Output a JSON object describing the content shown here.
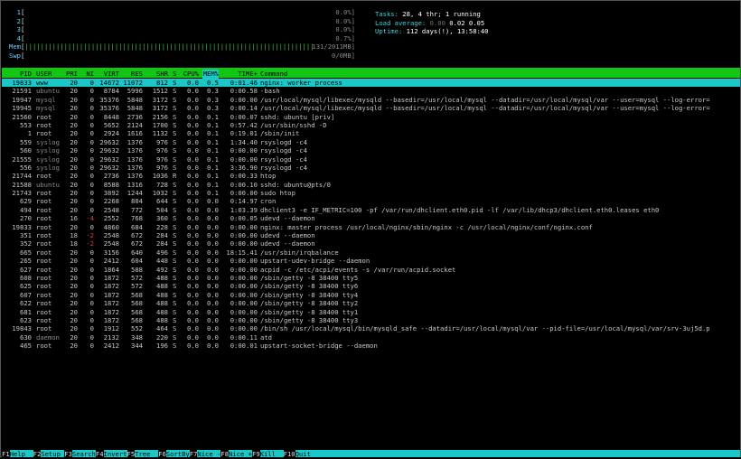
{
  "meters": [
    {
      "label": "1",
      "bar": "",
      "value": "0.0%]"
    },
    {
      "label": "2",
      "bar": "",
      "value": "0.0%]"
    },
    {
      "label": "3",
      "bar": "",
      "value": "0.0%]"
    },
    {
      "label": "4",
      "bar": "",
      "value": "0.7%]"
    },
    {
      "label": "Mem",
      "bar": "||||||||||||||||||||||||||||||||||||||||||||||||||||||||||||||||||||||||||",
      "value": "131/2011MB]"
    },
    {
      "label": "Swp",
      "bar": "",
      "value": "0/0MB]"
    }
  ],
  "stats": {
    "tasks_label": "Tasks: ",
    "tasks_value": "28, 4 thr; 1 running",
    "load_label": "Load average: ",
    "load_1": "0.00",
    "load_5": "0.02",
    "load_15": "0.05",
    "uptime_label": "Uptime: ",
    "uptime_value": "112 days(!), 13:58:40"
  },
  "columns": {
    "pid": "PID",
    "user": "USER",
    "pri": "PRI",
    "ni": "NI",
    "virt": "VIRT",
    "res": "RES",
    "shr": "SHR",
    "s": "S",
    "cpu": "CPU%",
    "mem": "MEM%",
    "time": "TIME+",
    "cmd": "Command"
  },
  "processes": [
    {
      "pid": "19833",
      "user": "www",
      "pri": "20",
      "ni": "0",
      "virt": "14672",
      "res": "11072",
      "shr": "812",
      "s": "S",
      "cpu": "0.0",
      "mem": "0.5",
      "time": "0:01.46",
      "cmd": "nginx: worker process"
    },
    {
      "pid": "21591",
      "user": "ubuntu",
      "pri": "20",
      "ni": "0",
      "virt": "8784",
      "res": "5996",
      "shr": "1512",
      "s": "S",
      "cpu": "0.0",
      "mem": "0.3",
      "time": "0:00.58",
      "cmd": "-bash"
    },
    {
      "pid": "19947",
      "user": "mysql",
      "pri": "20",
      "ni": "0",
      "virt": "35376",
      "res": "5848",
      "shr": "3172",
      "s": "S",
      "cpu": "0.0",
      "mem": "0.3",
      "time": "0:00.00",
      "cmd": "/usr/local/mysql/libexec/mysqld --basedir=/usr/local/mysql --datadir=/usr/local/mysql/var --user=mysql --log-error="
    },
    {
      "pid": "19945",
      "user": "mysql",
      "pri": "20",
      "ni": "0",
      "virt": "35376",
      "res": "5848",
      "shr": "3172",
      "s": "S",
      "cpu": "0.0",
      "mem": "0.3",
      "time": "0:00.14",
      "cmd": "/usr/local/mysql/libexec/mysqld --basedir=/usr/local/mysql --datadir=/usr/local/mysql/var --user=mysql --log-error="
    },
    {
      "pid": "21560",
      "user": "root",
      "pri": "20",
      "ni": "0",
      "virt": "8448",
      "res": "2736",
      "shr": "2156",
      "s": "S",
      "cpu": "0.0",
      "mem": "0.1",
      "time": "0:00.07",
      "cmd": "sshd: ubuntu [priv]"
    },
    {
      "pid": "553",
      "user": "root",
      "pri": "20",
      "ni": "0",
      "virt": "5652",
      "res": "2124",
      "shr": "1700",
      "s": "S",
      "cpu": "0.0",
      "mem": "0.1",
      "time": "0:57.42",
      "cmd": "/usr/sbin/sshd -D"
    },
    {
      "pid": "1",
      "user": "root",
      "pri": "20",
      "ni": "0",
      "virt": "2924",
      "res": "1616",
      "shr": "1132",
      "s": "S",
      "cpu": "0.0",
      "mem": "0.1",
      "time": "0:19.01",
      "cmd": "/sbin/init"
    },
    {
      "pid": "559",
      "user": "syslog",
      "pri": "20",
      "ni": "0",
      "virt": "29632",
      "res": "1376",
      "shr": "976",
      "s": "S",
      "cpu": "0.0",
      "mem": "0.1",
      "time": "1:34.40",
      "cmd": "rsyslogd -c4"
    },
    {
      "pid": "560",
      "user": "syslog",
      "pri": "20",
      "ni": "0",
      "virt": "29632",
      "res": "1376",
      "shr": "976",
      "s": "S",
      "cpu": "0.0",
      "mem": "0.1",
      "time": "0:00.00",
      "cmd": "rsyslogd -c4"
    },
    {
      "pid": "21555",
      "user": "syslog",
      "pri": "20",
      "ni": "0",
      "virt": "29632",
      "res": "1376",
      "shr": "976",
      "s": "S",
      "cpu": "0.0",
      "mem": "0.1",
      "time": "0:00.00",
      "cmd": "rsyslogd -c4"
    },
    {
      "pid": "556",
      "user": "syslog",
      "pri": "20",
      "ni": "0",
      "virt": "29632",
      "res": "1376",
      "shr": "976",
      "s": "S",
      "cpu": "0.0",
      "mem": "0.1",
      "time": "3:36.90",
      "cmd": "rsyslogd -c4"
    },
    {
      "pid": "21744",
      "user": "root",
      "pri": "20",
      "ni": "0",
      "virt": "2736",
      "res": "1376",
      "shr": "1036",
      "s": "R",
      "cpu": "0.0",
      "mem": "0.1",
      "time": "0:00.33",
      "cmd": "htop"
    },
    {
      "pid": "21588",
      "user": "ubuntu",
      "pri": "20",
      "ni": "0",
      "virt": "8588",
      "res": "1316",
      "shr": "728",
      "s": "S",
      "cpu": "0.0",
      "mem": "0.1",
      "time": "0:00.10",
      "cmd": "sshd: ubuntu@pts/0"
    },
    {
      "pid": "21743",
      "user": "root",
      "pri": "20",
      "ni": "0",
      "virt": "3892",
      "res": "1244",
      "shr": "1032",
      "s": "S",
      "cpu": "0.0",
      "mem": "0.1",
      "time": "0:00.00",
      "cmd": "sudo htop"
    },
    {
      "pid": "629",
      "user": "root",
      "pri": "20",
      "ni": "0",
      "virt": "2268",
      "res": "804",
      "shr": "644",
      "s": "S",
      "cpu": "0.0",
      "mem": "0.0",
      "time": "0:14.97",
      "cmd": "cron"
    },
    {
      "pid": "494",
      "user": "root",
      "pri": "20",
      "ni": "0",
      "virt": "2548",
      "res": "772",
      "shr": "504",
      "s": "S",
      "cpu": "0.0",
      "mem": "0.0",
      "time": "1:03.39",
      "cmd": "dhclient3 -e IF_METRIC=100 -pf /var/run/dhclient.eth0.pid -lf /var/lib/dhcp3/dhclient.eth0.leases eth0"
    },
    {
      "pid": "270",
      "user": "root",
      "pri": "16",
      "ni": "-4",
      "virt": "2552",
      "res": "768",
      "shr": "360",
      "s": "S",
      "cpu": "0.0",
      "mem": "0.0",
      "time": "0:00.05",
      "cmd": "udevd --daemon"
    },
    {
      "pid": "19833",
      "user": "root",
      "pri": "20",
      "ni": "0",
      "virt": "4860",
      "res": "684",
      "shr": "228",
      "s": "S",
      "cpu": "0.0",
      "mem": "0.0",
      "time": "0:00.00",
      "cmd": "nginx: master process /usr/local/nginx/sbin/nginx -c /usr/local/nginx/conf/nginx.conf"
    },
    {
      "pid": "351",
      "user": "root",
      "pri": "18",
      "ni": "-2",
      "virt": "2548",
      "res": "672",
      "shr": "284",
      "s": "S",
      "cpu": "0.0",
      "mem": "0.0",
      "time": "0:00.00",
      "cmd": "udevd --daemon"
    },
    {
      "pid": "352",
      "user": "root",
      "pri": "18",
      "ni": "-2",
      "virt": "2548",
      "res": "672",
      "shr": "284",
      "s": "S",
      "cpu": "0.0",
      "mem": "0.0",
      "time": "0:00.00",
      "cmd": "udevd --daemon"
    },
    {
      "pid": "665",
      "user": "root",
      "pri": "20",
      "ni": "0",
      "virt": "3156",
      "res": "640",
      "shr": "496",
      "s": "S",
      "cpu": "0.0",
      "mem": "0.0",
      "time": "18:15.41",
      "cmd": "/usr/sbin/irqbalance"
    },
    {
      "pid": "265",
      "user": "root",
      "pri": "20",
      "ni": "0",
      "virt": "2412",
      "res": "604",
      "shr": "448",
      "s": "S",
      "cpu": "0.0",
      "mem": "0.0",
      "time": "0:00.00",
      "cmd": "upstart-udev-bridge --daemon"
    },
    {
      "pid": "627",
      "user": "root",
      "pri": "20",
      "ni": "0",
      "virt": "1864",
      "res": "588",
      "shr": "492",
      "s": "S",
      "cpu": "0.0",
      "mem": "0.0",
      "time": "0:00.00",
      "cmd": "acpid -c /etc/acpi/events -s /var/run/acpid.socket"
    },
    {
      "pid": "608",
      "user": "root",
      "pri": "20",
      "ni": "0",
      "virt": "1872",
      "res": "572",
      "shr": "488",
      "s": "S",
      "cpu": "0.0",
      "mem": "0.0",
      "time": "0:00.00",
      "cmd": "/sbin/getty -8 38400 tty5"
    },
    {
      "pid": "625",
      "user": "root",
      "pri": "20",
      "ni": "0",
      "virt": "1872",
      "res": "572",
      "shr": "488",
      "s": "S",
      "cpu": "0.0",
      "mem": "0.0",
      "time": "0:00.00",
      "cmd": "/sbin/getty -8 38400 tty6"
    },
    {
      "pid": "607",
      "user": "root",
      "pri": "20",
      "ni": "0",
      "virt": "1872",
      "res": "568",
      "shr": "488",
      "s": "S",
      "cpu": "0.0",
      "mem": "0.0",
      "time": "0:00.00",
      "cmd": "/sbin/getty -8 38400 tty4"
    },
    {
      "pid": "622",
      "user": "root",
      "pri": "20",
      "ni": "0",
      "virt": "1872",
      "res": "568",
      "shr": "488",
      "s": "S",
      "cpu": "0.0",
      "mem": "0.0",
      "time": "0:00.00",
      "cmd": "/sbin/getty -8 38400 tty2"
    },
    {
      "pid": "681",
      "user": "root",
      "pri": "20",
      "ni": "0",
      "virt": "1872",
      "res": "568",
      "shr": "488",
      "s": "S",
      "cpu": "0.0",
      "mem": "0.0",
      "time": "0:00.00",
      "cmd": "/sbin/getty -8 38400 tty1"
    },
    {
      "pid": "623",
      "user": "root",
      "pri": "20",
      "ni": "0",
      "virt": "1872",
      "res": "568",
      "shr": "488",
      "s": "S",
      "cpu": "0.0",
      "mem": "0.0",
      "time": "0:00.00",
      "cmd": "/sbin/getty -8 38400 tty3"
    },
    {
      "pid": "19843",
      "user": "root",
      "pri": "20",
      "ni": "0",
      "virt": "1912",
      "res": "552",
      "shr": "464",
      "s": "S",
      "cpu": "0.0",
      "mem": "0.0",
      "time": "0:00.00",
      "cmd": "/bin/sh /usr/local/mysql/bin/mysqld_safe --datadir=/usr/local/mysql/var --pid-file=/usr/local/mysql/var/srv-3uj5d.p"
    },
    {
      "pid": "630",
      "user": "daemon",
      "pri": "20",
      "ni": "0",
      "virt": "2132",
      "res": "348",
      "shr": "220",
      "s": "S",
      "cpu": "0.0",
      "mem": "0.0",
      "time": "0:00.11",
      "cmd": "atd"
    },
    {
      "pid": "465",
      "user": "root",
      "pri": "20",
      "ni": "0",
      "virt": "2412",
      "res": "344",
      "shr": "196",
      "s": "S",
      "cpu": "0.0",
      "mem": "0.0",
      "time": "0:00.01",
      "cmd": "upstart-socket-bridge --daemon"
    }
  ],
  "footer": [
    {
      "key": "F1",
      "label": "Help  "
    },
    {
      "key": "F2",
      "label": "Setup "
    },
    {
      "key": "F3",
      "label": "Search"
    },
    {
      "key": "F4",
      "label": "Invert"
    },
    {
      "key": "F5",
      "label": "Tree  "
    },
    {
      "key": "F6",
      "label": "SortBy"
    },
    {
      "key": "F7",
      "label": "Nice -"
    },
    {
      "key": "F8",
      "label": "Nice +"
    },
    {
      "key": "F9",
      "label": "Kill  "
    },
    {
      "key": "F10",
      "label": "Quit  "
    }
  ],
  "colors": {
    "header_bg": "#12c712",
    "selected_bg": "#1ac8c8",
    "footer_bg": "#1ac8c8",
    "bar": "#3fcc3f",
    "info": "#3fcfcf"
  }
}
